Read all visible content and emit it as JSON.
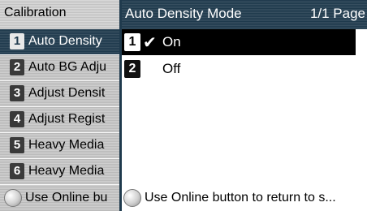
{
  "left_panel": {
    "title": "Calibration",
    "items": [
      {
        "num": "1",
        "label": "Auto Density",
        "selected": true
      },
      {
        "num": "2",
        "label": "Auto BG Adju",
        "selected": false
      },
      {
        "num": "3",
        "label": "Adjust Densit",
        "selected": false
      },
      {
        "num": "4",
        "label": "Adjust Regist",
        "selected": false
      },
      {
        "num": "5",
        "label": "Heavy Media",
        "selected": false
      },
      {
        "num": "6",
        "label": "Heavy Media",
        "selected": false
      }
    ],
    "footer_label": "Use Online bu"
  },
  "right_panel": {
    "title": "Auto Density Mode",
    "page_indicator": "1/1 Page",
    "options": [
      {
        "num": "1",
        "label": "On",
        "selected": true,
        "checked": true,
        "check_icon": "check-icon"
      },
      {
        "num": "2",
        "label": "Off",
        "selected": false,
        "checked": false
      }
    ],
    "footer_label": "Use Online button to return to s..."
  },
  "colors": {
    "accent_dark": "#1f3a4d",
    "selected_option": "#000000",
    "menu_gray": "#cfcfcf"
  }
}
